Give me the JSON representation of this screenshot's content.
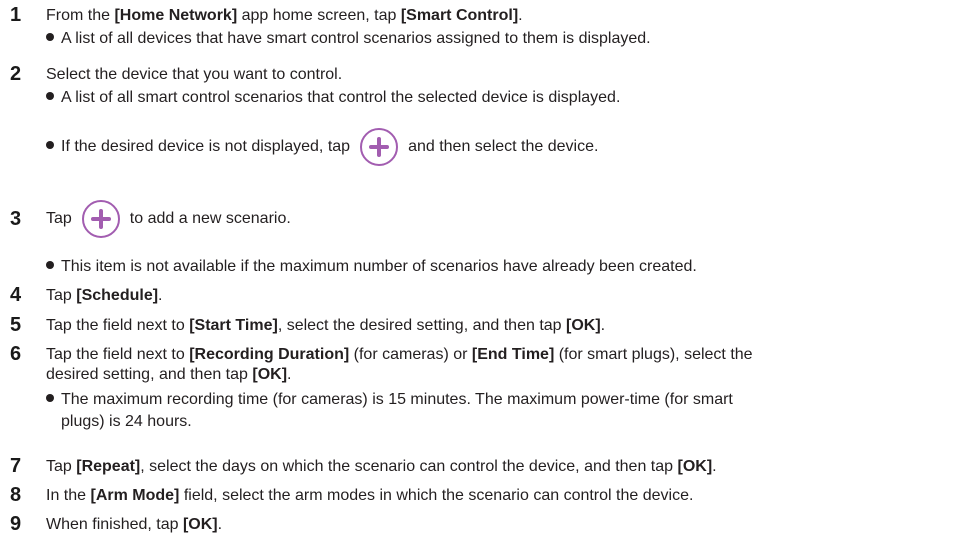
{
  "steps": [
    {
      "num": "1",
      "parts": [
        "From the ",
        "[Home Network]",
        " app home screen, tap ",
        "[Smart Control]",
        "."
      ],
      "bullets": [
        "A list of all devices that have smart control scenarios assigned to them is displayed."
      ]
    },
    {
      "num": "2",
      "text": "Select the device that you want to control.",
      "bullets": [
        "A list of all smart control scenarios that control the selected device is displayed."
      ],
      "bullet_icon": {
        "before": "If the desired device is not displayed, tap",
        "after": "and then select the device.",
        "icon": "plus-circle-icon"
      }
    },
    {
      "num": "3",
      "before": "Tap",
      "after": "to add a new scenario.",
      "icon": "plus-circle-icon",
      "bullets": [
        "This item is not available if the maximum number of scenarios have already been created."
      ]
    },
    {
      "num": "4",
      "parts": [
        "Tap ",
        "[Schedule]",
        "."
      ]
    },
    {
      "num": "5",
      "parts": [
        "Tap the field next to ",
        "[Start Time]",
        ", select the desired setting, and then tap ",
        "[OK]",
        "."
      ]
    },
    {
      "num": "6",
      "parts": [
        "Tap the field next to ",
        "[Recording Duration]",
        " (for cameras) or ",
        "[End Time]",
        " (for smart plugs), select the"
      ],
      "parts2": [
        "desired setting, and then tap ",
        "[OK]",
        "."
      ],
      "bullets": [
        "The maximum recording time (for cameras) is 15 minutes. The maximum power-time (for smart"
      ],
      "bullet_cont": "plugs) is 24 hours."
    },
    {
      "num": "7",
      "parts": [
        "Tap ",
        "[Repeat]",
        ", select the days on which the scenario can control the device, and then tap ",
        "[OK]",
        "."
      ]
    },
    {
      "num": "8",
      "parts": [
        "In the ",
        "[Arm Mode]",
        " field, select the arm modes in which the scenario can control the device."
      ]
    },
    {
      "num": "9",
      "parts": [
        "When finished, tap ",
        "[OK]",
        "."
      ]
    }
  ],
  "colors": {
    "icon": "#a25db0",
    "text": "#231f20"
  }
}
